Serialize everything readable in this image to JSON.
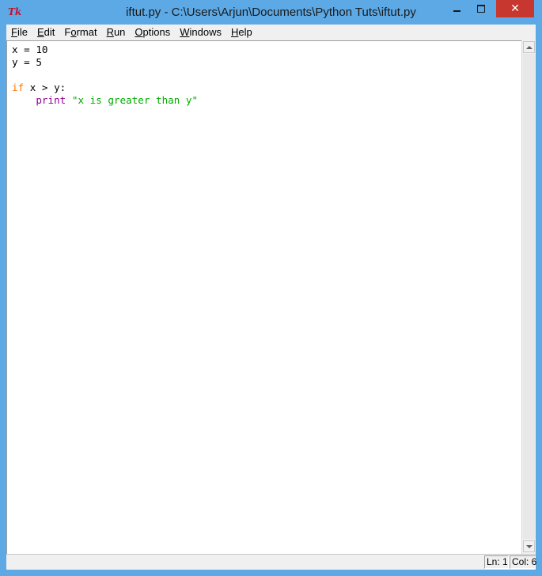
{
  "window": {
    "title": "iftut.py - C:\\Users\\Arjun\\Documents\\Python Tuts\\iftut.py",
    "app_icon_text": "Tk",
    "close_glyph": "✕"
  },
  "menu": {
    "items": [
      {
        "accel": "F",
        "rest": "ile"
      },
      {
        "accel": "E",
        "rest": "dit"
      },
      {
        "accel": "",
        "pre": "F",
        "accel2": "o",
        "rest": "rmat"
      },
      {
        "accel": "R",
        "rest": "un"
      },
      {
        "accel": "O",
        "rest": "ptions"
      },
      {
        "accel": "W",
        "rest": "indows"
      },
      {
        "accel": "H",
        "rest": "elp"
      }
    ]
  },
  "editor": {
    "lines": [
      "x = 10",
      "y = 5",
      "",
      "if x > y:",
      "    print \"x is greater than y\""
    ],
    "tokens": {
      "line1": "x = 10",
      "line2": "y = 5",
      "line4_kw": "if",
      "line4_rest": " x > y:",
      "line5_indent": "    ",
      "line5_builtin": "print",
      "line5_space": " ",
      "line5_str": "\"x is greater than y\""
    },
    "colors": {
      "keyword": "#ff7700",
      "builtin": "#900090",
      "string": "#00aa00"
    }
  },
  "status": {
    "ln": "Ln: 1",
    "col": "Col: 6"
  }
}
